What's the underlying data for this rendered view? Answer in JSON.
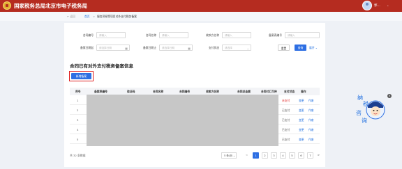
{
  "header": {
    "site_title": "国家税务总局北京市电子税务局",
    "user_name": "郭...",
    "user_caret": "⌄"
  },
  "breadcrumb": {
    "back": "← 返回",
    "home": "首页",
    "separator": ">",
    "current": "服务贸易等项目对外支付税务备案"
  },
  "filters": {
    "contract_no": {
      "label": "合同编号",
      "placeholder": "请输入"
    },
    "contract_name": {
      "label": "合同名称",
      "placeholder": "请输入"
    },
    "payee_name": {
      "label": "收款方名称",
      "placeholder": "请输入"
    },
    "filing_no": {
      "label": "备案表编号",
      "placeholder": "请输入"
    },
    "date_start": {
      "label": "备案日期起",
      "placeholder": "请选择日期"
    },
    "date_end": {
      "label": "备案日期止",
      "placeholder": "请选择日期"
    },
    "pay_status": {
      "label": "支付状态",
      "placeholder": "请选择"
    },
    "reset_label": "重置",
    "query_label": "查询",
    "expand_label": "展开 ⌄"
  },
  "section": {
    "title": "合同已有对外支付税务备案信息",
    "add_label": "新增备案"
  },
  "table": {
    "headers": [
      "序号",
      "备案表编号",
      "验证码",
      "合同名称",
      "合同编号",
      "收款方名称",
      "合同总金额",
      "合同付汇币种",
      "支付状态",
      "操作"
    ],
    "rows": [
      {
        "seq": "1",
        "status": "未支付",
        "a1": "变更",
        "a2": "作废"
      },
      {
        "seq": "2",
        "status": "已支付",
        "a1": "变更",
        "a2": "作废"
      },
      {
        "seq": "3",
        "status": "已支付",
        "a1": "变更",
        "a2": "作废"
      },
      {
        "seq": "4",
        "status": "已支付",
        "a1": "变更",
        "a2": "作废"
      },
      {
        "seq": "5",
        "status": "已支付",
        "a1": "变更",
        "a2": "作废"
      }
    ]
  },
  "pagination": {
    "total": "共 32 条数据",
    "page_size": "5 条/页 ⌄",
    "prev": "<",
    "pages": [
      "1",
      "2",
      "3",
      "4",
      "5",
      "6",
      "7"
    ],
    "next": ">",
    "active_page": "1"
  },
  "mascot": {
    "characters": [
      "纳",
      "税",
      "咨",
      "询"
    ],
    "close": "×",
    "icon": "mascot-icon"
  },
  "colors": {
    "header_red": "#b52c20",
    "primary_blue": "#2e6fe3",
    "status_red": "#e02323"
  }
}
